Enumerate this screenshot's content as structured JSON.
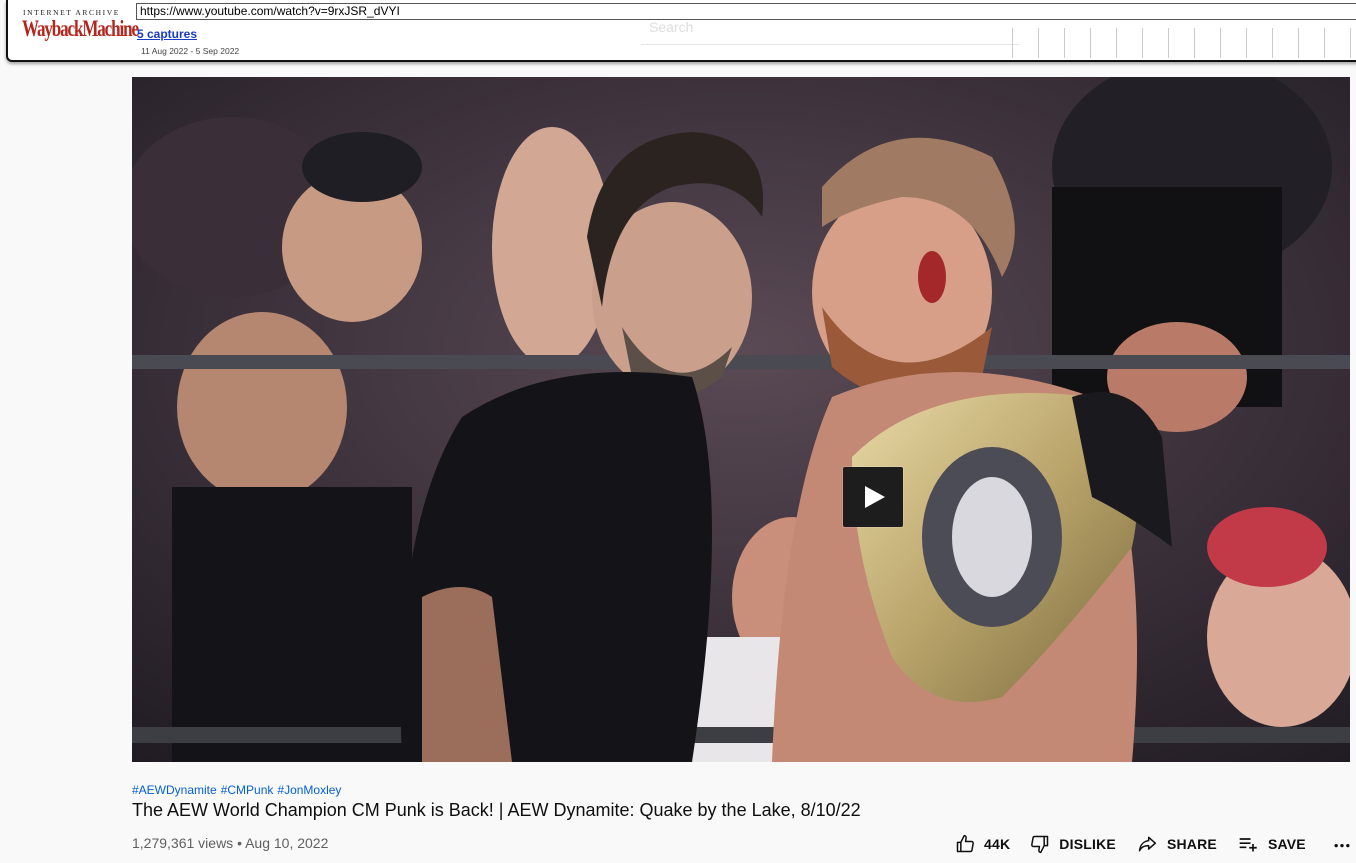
{
  "wayback": {
    "logo_top": "INTERNET ARCHIVE",
    "logo_main": "WaybackMachine",
    "url": "https://www.youtube.com/watch?v=9rxJSR_dVYI",
    "captures": "5 captures",
    "range": "11 Aug 2022 - 5 Sep 2022",
    "ghost_search": "Search"
  },
  "video": {
    "play_icon": "play-icon",
    "hashtags": [
      "#AEWDynamite",
      "#CMPunk",
      "#JonMoxley"
    ],
    "title": "The AEW World Champion CM Punk is Back! | AEW Dynamite: Quake by the Lake, 8/10/22",
    "meta": "1,279,361 views • Aug 10, 2022"
  },
  "actions": {
    "like_count": "44K",
    "dislike_label": "DISLIKE",
    "share_label": "SHARE",
    "save_label": "SAVE",
    "icons": [
      "thumb-up-icon",
      "thumb-down-icon",
      "share-icon",
      "playlist-add-icon",
      "more-icon"
    ]
  }
}
